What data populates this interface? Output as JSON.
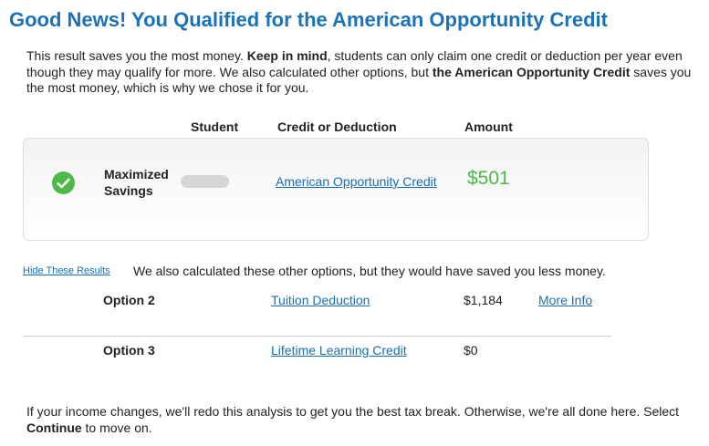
{
  "page": {
    "title": "Good News! You Qualified for the American Opportunity Credit",
    "intro": {
      "part1": "This result saves you the most money. ",
      "bold1": "Keep in mind",
      "part2": ", students can only claim one credit or deduction per year even though they may qualify for more. We also calculated other options, but ",
      "bold2": "the American Opportunity Credit",
      "part3": " saves you the most money, which is why we chose it for you."
    }
  },
  "table": {
    "headers": {
      "student": "Student",
      "credit": "Credit or Deduction",
      "amount": "Amount"
    },
    "best": {
      "label_line1": "Maximized",
      "label_line2": "Savings",
      "credit": "American Opportunity Credit",
      "amount": "$501",
      "icon": "check-circle-icon",
      "accent_color": "#4dba48"
    }
  },
  "other_options": {
    "hide_link": "Hide These Results",
    "note": "We also calculated these other options, but they would have saved you less money.",
    "rows": [
      {
        "label": "Option 2",
        "credit": "Tuition Deduction",
        "amount": "$1,184",
        "more": "More Info"
      },
      {
        "label": "Option 3",
        "credit": "Lifetime Learning Credit",
        "amount": "$0"
      }
    ]
  },
  "footer": {
    "part1": "If your income changes, we'll redo this analysis to get you the best tax break. Otherwise, we're all done here. Select ",
    "bold": "Continue",
    "part2": " to move on."
  },
  "colors": {
    "title": "#1c72b8",
    "link": "#1a6fb5",
    "success": "#4dba48"
  }
}
